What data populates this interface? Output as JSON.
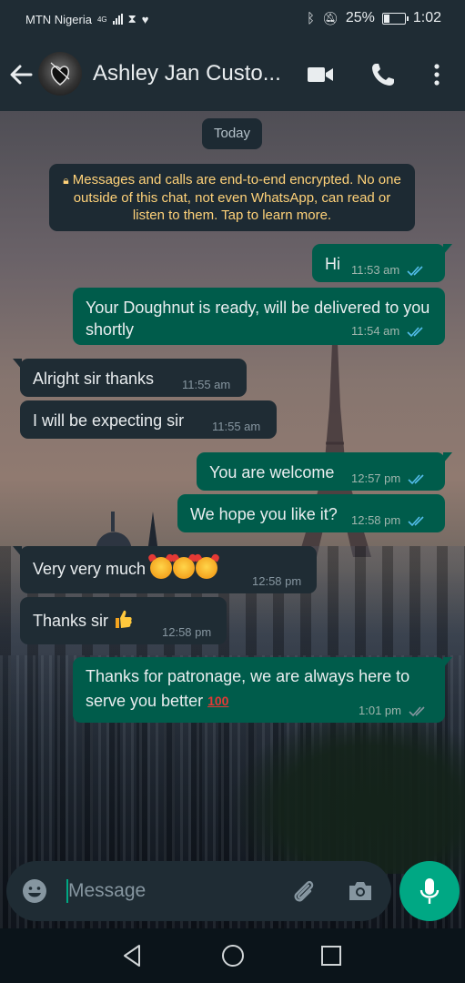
{
  "status_bar": {
    "carrier": "MTN Nigeria",
    "network": "4G",
    "battery": "25%",
    "time": "1:02"
  },
  "header": {
    "contact_name": "Ashley Jan Custo..."
  },
  "chat": {
    "date_chip": "Today",
    "encryption_notice": "Messages and calls are end-to-end encrypted. No one outside of this chat, not even WhatsApp, can read or listen to them. Tap to learn more.",
    "messages": [
      {
        "direction": "out",
        "text": "Hi",
        "time": "11:53 am"
      },
      {
        "direction": "out",
        "text": "Your Doughnut is ready, will be delivered to you shortly",
        "time": "11:54 am"
      },
      {
        "direction": "in",
        "text": "Alright sir thanks",
        "time": "11:55 am"
      },
      {
        "direction": "in",
        "text": "I will be expecting sir",
        "time": "11:55 am"
      },
      {
        "direction": "out",
        "text": "You are welcome",
        "time": "12:57 pm"
      },
      {
        "direction": "out",
        "text": "We hope you like it?",
        "time": "12:58 pm"
      },
      {
        "direction": "in",
        "text": "Very very much",
        "time": "12:58 pm"
      },
      {
        "direction": "in",
        "text": "Thanks sir",
        "time": "12:58 pm"
      },
      {
        "direction": "out",
        "text": "Thanks for patronage, we are always here to serve you better",
        "time": "1:01 pm"
      }
    ]
  },
  "composer": {
    "placeholder": "Message"
  },
  "colors": {
    "outgoing_bubble": "#005c4b",
    "incoming_bubble": "#1f2c34",
    "accent": "#00a884",
    "read_tick": "#53bdeb",
    "unread_tick": "#8696a0"
  }
}
